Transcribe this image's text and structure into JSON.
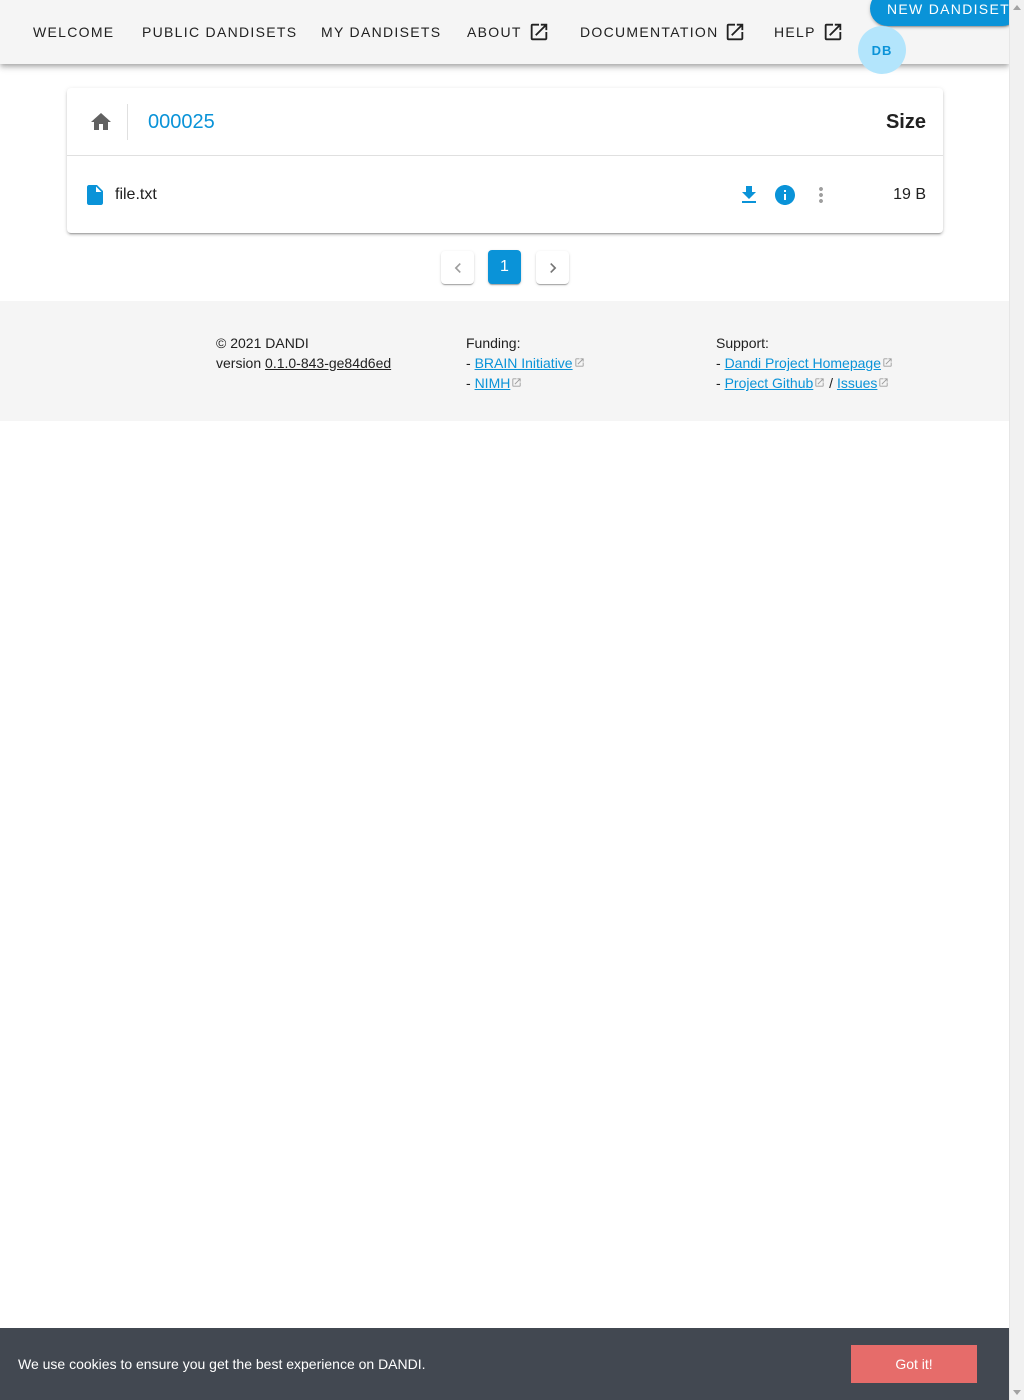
{
  "nav": {
    "welcome": "Welcome",
    "public_dandisets": "Public Dandisets",
    "my_dandisets": "My Dandisets",
    "about": "About",
    "documentation": "Documentation",
    "help": "Help",
    "new_dandiset": "NEW DANDISET",
    "avatar_initials": "DB"
  },
  "browser": {
    "breadcrumb": "000025",
    "size_header": "Size",
    "files": [
      {
        "name": "file.txt",
        "size": "19 B"
      }
    ]
  },
  "pagination": {
    "current_page": "1"
  },
  "footer": {
    "copyright": "© 2021 DANDI",
    "version_label": "version",
    "version": "0.1.0-843-ge84d6ed",
    "funding_title": "Funding:",
    "dash": "-",
    "slash": "/",
    "funding_links": [
      "BRAIN Initiative",
      "NIMH"
    ],
    "support_title": "Support:",
    "support_links": [
      "Dandi Project Homepage",
      "Project Github",
      "Issues"
    ]
  },
  "cookie": {
    "message": "We use cookies to ensure you get the best experience on DANDI.",
    "button": "Got it!"
  },
  "colors": {
    "primary": "#0a93d8",
    "appbar_bg": "#f5f5f5",
    "cookie_bg": "#424851",
    "cookie_button": "#e66c6a",
    "avatar_bg": "#b3e5fc"
  }
}
